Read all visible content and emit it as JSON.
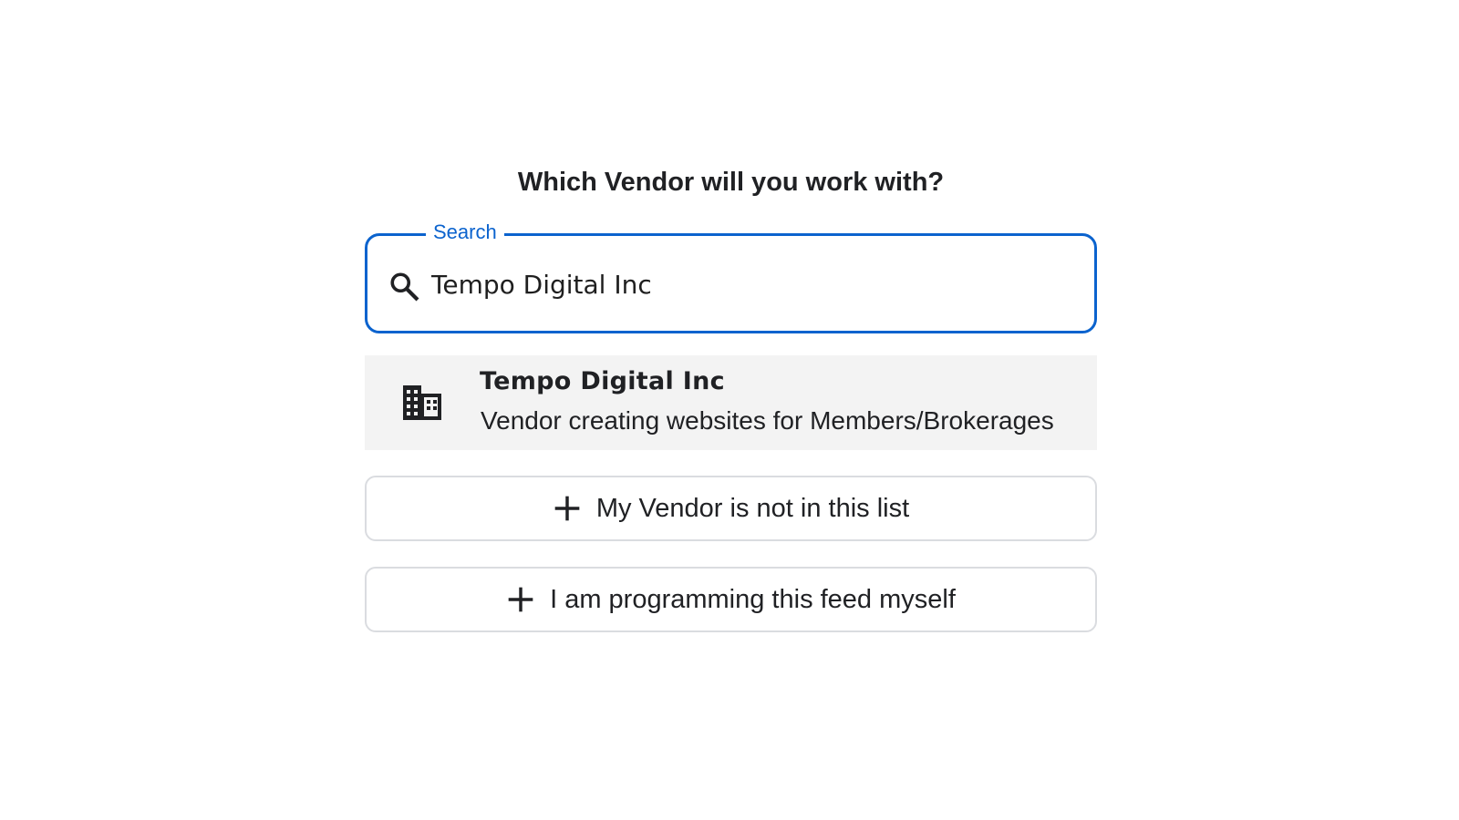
{
  "prompt": {
    "question": "Which Vendor will you work with?"
  },
  "search": {
    "label": "Search",
    "value": "Tempo Digital Inc",
    "icon": "search-icon",
    "focus_color": "#0b63ce"
  },
  "results": [
    {
      "icon": "building-icon",
      "title": "Tempo Digital Inc",
      "description": "Vendor creating websites for Members/Brokerages"
    }
  ],
  "actions": {
    "vendor_not_listed": {
      "icon": "plus-icon",
      "label": "My Vendor is not in this list"
    },
    "programming_myself": {
      "icon": "plus-icon",
      "label": "I am programming this feed myself"
    }
  }
}
